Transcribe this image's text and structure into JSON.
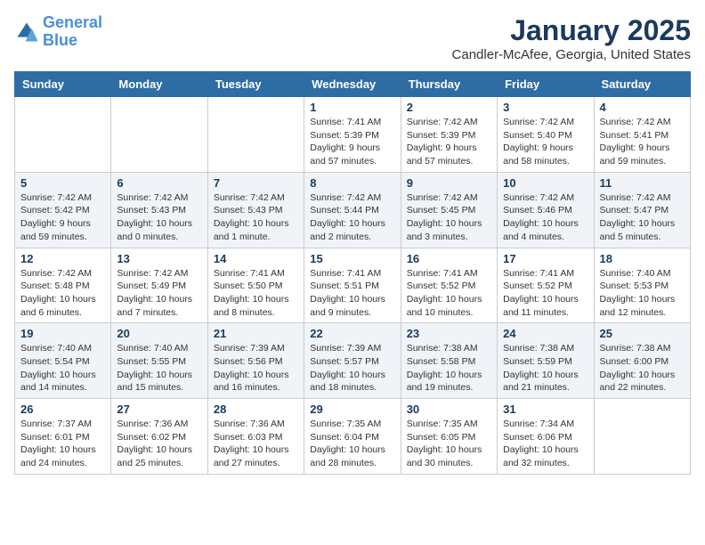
{
  "logo": {
    "line1": "General",
    "line2": "Blue"
  },
  "title": "January 2025",
  "subtitle": "Candler-McAfee, Georgia, United States",
  "days_of_week": [
    "Sunday",
    "Monday",
    "Tuesday",
    "Wednesday",
    "Thursday",
    "Friday",
    "Saturday"
  ],
  "weeks": [
    [
      {
        "num": "",
        "detail": ""
      },
      {
        "num": "",
        "detail": ""
      },
      {
        "num": "",
        "detail": ""
      },
      {
        "num": "1",
        "detail": "Sunrise: 7:41 AM\nSunset: 5:39 PM\nDaylight: 9 hours\nand 57 minutes."
      },
      {
        "num": "2",
        "detail": "Sunrise: 7:42 AM\nSunset: 5:39 PM\nDaylight: 9 hours\nand 57 minutes."
      },
      {
        "num": "3",
        "detail": "Sunrise: 7:42 AM\nSunset: 5:40 PM\nDaylight: 9 hours\nand 58 minutes."
      },
      {
        "num": "4",
        "detail": "Sunrise: 7:42 AM\nSunset: 5:41 PM\nDaylight: 9 hours\nand 59 minutes."
      }
    ],
    [
      {
        "num": "5",
        "detail": "Sunrise: 7:42 AM\nSunset: 5:42 PM\nDaylight: 9 hours\nand 59 minutes."
      },
      {
        "num": "6",
        "detail": "Sunrise: 7:42 AM\nSunset: 5:43 PM\nDaylight: 10 hours\nand 0 minutes."
      },
      {
        "num": "7",
        "detail": "Sunrise: 7:42 AM\nSunset: 5:43 PM\nDaylight: 10 hours\nand 1 minute."
      },
      {
        "num": "8",
        "detail": "Sunrise: 7:42 AM\nSunset: 5:44 PM\nDaylight: 10 hours\nand 2 minutes."
      },
      {
        "num": "9",
        "detail": "Sunrise: 7:42 AM\nSunset: 5:45 PM\nDaylight: 10 hours\nand 3 minutes."
      },
      {
        "num": "10",
        "detail": "Sunrise: 7:42 AM\nSunset: 5:46 PM\nDaylight: 10 hours\nand 4 minutes."
      },
      {
        "num": "11",
        "detail": "Sunrise: 7:42 AM\nSunset: 5:47 PM\nDaylight: 10 hours\nand 5 minutes."
      }
    ],
    [
      {
        "num": "12",
        "detail": "Sunrise: 7:42 AM\nSunset: 5:48 PM\nDaylight: 10 hours\nand 6 minutes."
      },
      {
        "num": "13",
        "detail": "Sunrise: 7:42 AM\nSunset: 5:49 PM\nDaylight: 10 hours\nand 7 minutes."
      },
      {
        "num": "14",
        "detail": "Sunrise: 7:41 AM\nSunset: 5:50 PM\nDaylight: 10 hours\nand 8 minutes."
      },
      {
        "num": "15",
        "detail": "Sunrise: 7:41 AM\nSunset: 5:51 PM\nDaylight: 10 hours\nand 9 minutes."
      },
      {
        "num": "16",
        "detail": "Sunrise: 7:41 AM\nSunset: 5:52 PM\nDaylight: 10 hours\nand 10 minutes."
      },
      {
        "num": "17",
        "detail": "Sunrise: 7:41 AM\nSunset: 5:52 PM\nDaylight: 10 hours\nand 11 minutes."
      },
      {
        "num": "18",
        "detail": "Sunrise: 7:40 AM\nSunset: 5:53 PM\nDaylight: 10 hours\nand 12 minutes."
      }
    ],
    [
      {
        "num": "19",
        "detail": "Sunrise: 7:40 AM\nSunset: 5:54 PM\nDaylight: 10 hours\nand 14 minutes."
      },
      {
        "num": "20",
        "detail": "Sunrise: 7:40 AM\nSunset: 5:55 PM\nDaylight: 10 hours\nand 15 minutes."
      },
      {
        "num": "21",
        "detail": "Sunrise: 7:39 AM\nSunset: 5:56 PM\nDaylight: 10 hours\nand 16 minutes."
      },
      {
        "num": "22",
        "detail": "Sunrise: 7:39 AM\nSunset: 5:57 PM\nDaylight: 10 hours\nand 18 minutes."
      },
      {
        "num": "23",
        "detail": "Sunrise: 7:38 AM\nSunset: 5:58 PM\nDaylight: 10 hours\nand 19 minutes."
      },
      {
        "num": "24",
        "detail": "Sunrise: 7:38 AM\nSunset: 5:59 PM\nDaylight: 10 hours\nand 21 minutes."
      },
      {
        "num": "25",
        "detail": "Sunrise: 7:38 AM\nSunset: 6:00 PM\nDaylight: 10 hours\nand 22 minutes."
      }
    ],
    [
      {
        "num": "26",
        "detail": "Sunrise: 7:37 AM\nSunset: 6:01 PM\nDaylight: 10 hours\nand 24 minutes."
      },
      {
        "num": "27",
        "detail": "Sunrise: 7:36 AM\nSunset: 6:02 PM\nDaylight: 10 hours\nand 25 minutes."
      },
      {
        "num": "28",
        "detail": "Sunrise: 7:36 AM\nSunset: 6:03 PM\nDaylight: 10 hours\nand 27 minutes."
      },
      {
        "num": "29",
        "detail": "Sunrise: 7:35 AM\nSunset: 6:04 PM\nDaylight: 10 hours\nand 28 minutes."
      },
      {
        "num": "30",
        "detail": "Sunrise: 7:35 AM\nSunset: 6:05 PM\nDaylight: 10 hours\nand 30 minutes."
      },
      {
        "num": "31",
        "detail": "Sunrise: 7:34 AM\nSunset: 6:06 PM\nDaylight: 10 hours\nand 32 minutes."
      },
      {
        "num": "",
        "detail": ""
      }
    ]
  ]
}
